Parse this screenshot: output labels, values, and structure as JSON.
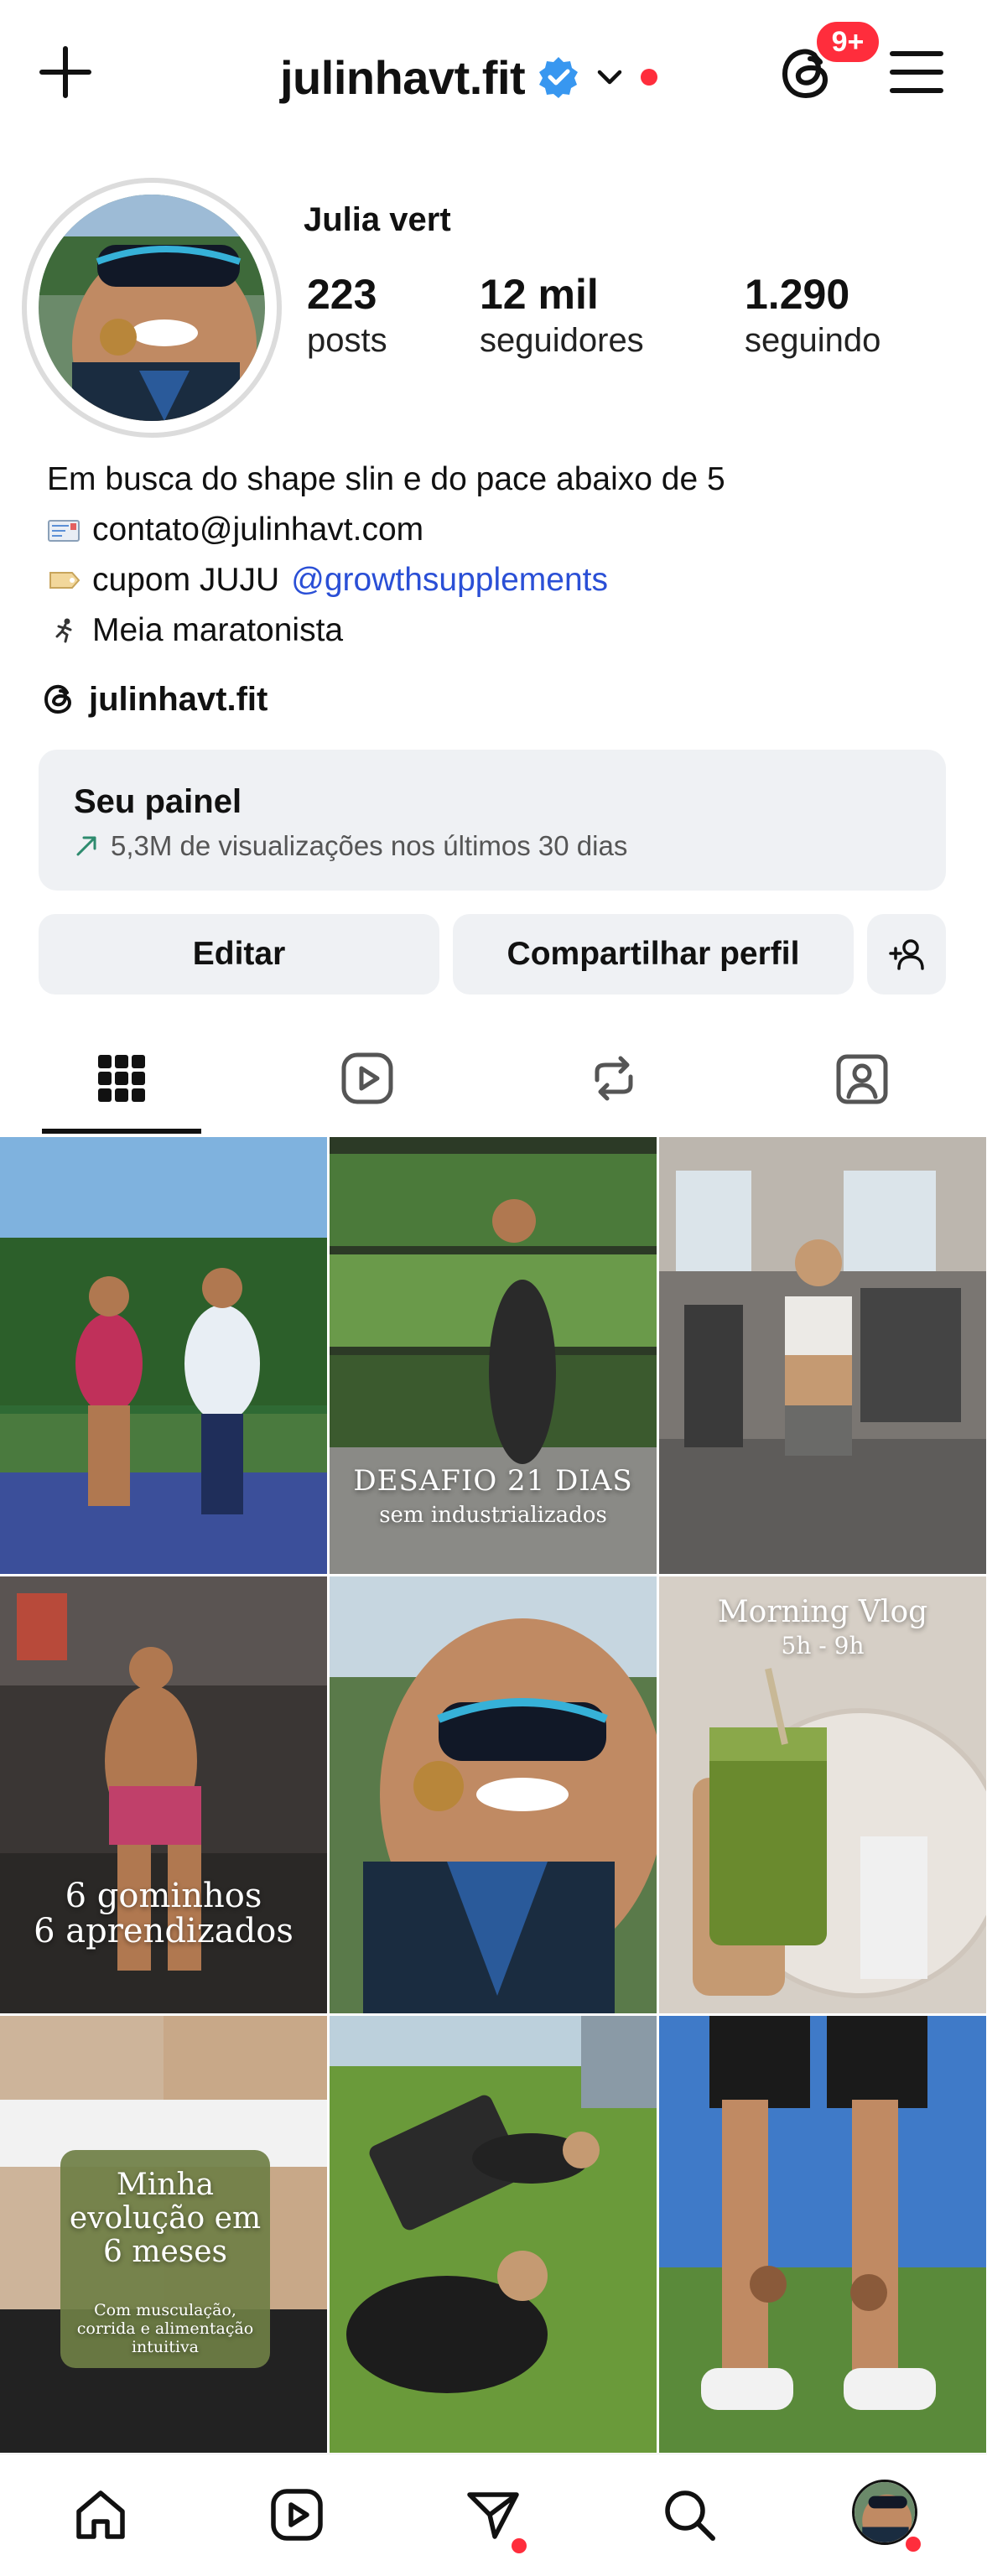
{
  "header": {
    "username": "julinhavt.fit",
    "notification_badge": "9+",
    "accent_red": "#ff2d3c",
    "verified_color": "#3897f0"
  },
  "profile": {
    "display_name": "Julia vert",
    "stats": [
      {
        "value": "223",
        "label": "posts"
      },
      {
        "value": "12 mil",
        "label": "seguidores"
      },
      {
        "value": "1.290",
        "label": "seguindo"
      }
    ],
    "bio": {
      "line1": "Em busca do shape slin e do pace abaixo de 5",
      "line2": "contato@julinhavt.com",
      "line3_text": "cupom JUJU",
      "line3_link": "@growthsupplements",
      "line4": "Meia maratonista"
    },
    "threads_handle": "julinhavt.fit"
  },
  "dashboard": {
    "title": "Seu painel",
    "subtitle": "5,3M de visualizações nos últimos 30 dias"
  },
  "actions": {
    "edit_label": "Editar",
    "share_label": "Compartilhar perfil"
  },
  "tabs": [
    "grid-icon",
    "reels-icon",
    "reposts-icon",
    "tagged-icon"
  ],
  "posts": [
    {
      "id": "post-1",
      "overlay_line1": "",
      "overlay_line2": ""
    },
    {
      "id": "post-2",
      "overlay_line1": "DESAFIO 21 DIAS",
      "overlay_line2": "sem industrializados"
    },
    {
      "id": "post-3",
      "overlay_line1": "",
      "overlay_line2": ""
    },
    {
      "id": "post-4",
      "overlay_line1": "6 gominhos",
      "overlay_line2": "6 aprendizados"
    },
    {
      "id": "post-5",
      "overlay_line1": "",
      "overlay_line2": ""
    },
    {
      "id": "post-6",
      "overlay_line1": "Morning Vlog",
      "overlay_line2": "5h - 9h"
    },
    {
      "id": "post-7",
      "overlay_line1": "Minha evolução em 6 meses",
      "overlay_line2": "Com musculação, corrida e alimentação intuitiva"
    },
    {
      "id": "post-8",
      "overlay_line1": "",
      "overlay_line2": ""
    },
    {
      "id": "post-9",
      "overlay_line1": "",
      "overlay_line2": ""
    }
  ],
  "bottom_nav": [
    "home-icon",
    "reels-icon",
    "direct-messages-icon",
    "search-icon",
    "profile-avatar"
  ]
}
